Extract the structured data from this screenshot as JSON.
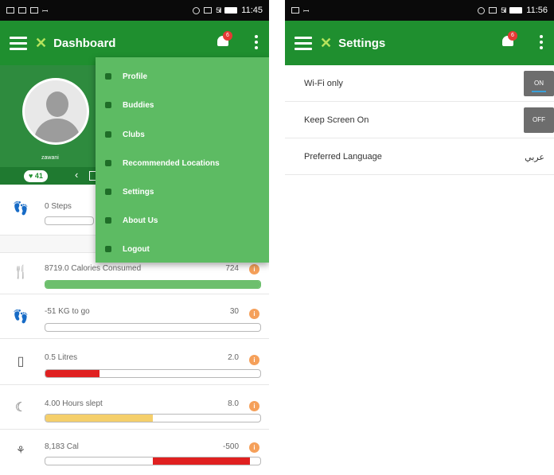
{
  "left_screen": {
    "statusbar": {
      "time": "11:45",
      "signal": "5il"
    },
    "appbar": {
      "title": "Dashboard",
      "notification_count": "6"
    },
    "profile": {
      "username": "zawani",
      "likes": "41"
    },
    "menu_items": [
      {
        "label": "Profile",
        "icon": "profile-icon"
      },
      {
        "label": "Buddies",
        "icon": "buddies-icon"
      },
      {
        "label": "Clubs",
        "icon": "clubs-icon"
      },
      {
        "label": "Recommended Locations",
        "icon": "location-icon"
      },
      {
        "label": "Settings",
        "icon": "gear-icon"
      },
      {
        "label": "About Us",
        "icon": "info-icon"
      },
      {
        "label": "Logout",
        "icon": "logout-icon"
      }
    ],
    "metrics": {
      "steps": {
        "label": "0 Steps",
        "icon": "footprints-icon",
        "progress": 0
      },
      "calories": {
        "label": "8719.0 Calories Consumed",
        "target": "724",
        "icon": "cutlery-icon",
        "progress": 1.0,
        "fill_color": "#6dbf6d"
      },
      "weight": {
        "label": "-51 KG to go",
        "target": "30",
        "icon": "scale-icon",
        "progress": 0
      },
      "water": {
        "label": "0.5 Litres",
        "target": "2.0",
        "icon": "glass-icon",
        "progress": 0.25,
        "fill_color": "#e02020"
      },
      "sleep": {
        "label": "4.00 Hours slept",
        "target": "8.0",
        "icon": "moon-icon",
        "progress": 0.5,
        "fill_color": "#f5cf6b"
      },
      "calorie_balance": {
        "label": "8,183 Cal",
        "target": "-500",
        "icon": "activity-icon",
        "fill_start": 0.5,
        "fill_end": 0.95,
        "fill_color": "#e02020"
      }
    },
    "dot_label": "i"
  },
  "right_screen": {
    "statusbar": {
      "time": "11:56",
      "signal": "5il"
    },
    "appbar": {
      "title": "Settings",
      "notification_count": "6"
    },
    "settings": [
      {
        "label": "Wi-Fi only",
        "value": "ON"
      },
      {
        "label": "Keep Screen On",
        "value": "OFF"
      },
      {
        "label": "Preferred Language",
        "value": "عربي"
      }
    ]
  },
  "colors": {
    "appbar": "#1f8f2f",
    "menu": "#5dbb63",
    "accent_orange": "#f5a05a"
  }
}
